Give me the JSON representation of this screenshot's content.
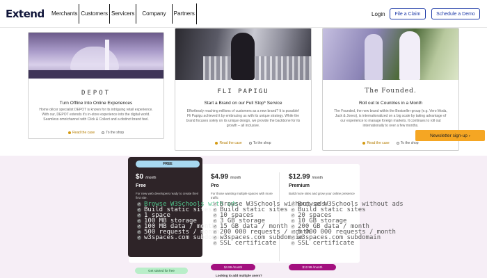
{
  "header": {
    "logo": "Extend",
    "nav": [
      "Merchants",
      "Customers",
      "Servicers",
      "Company",
      "Partners"
    ],
    "login": "Login",
    "file_claim": "File a Claim",
    "schedule_demo": "Schedule a Demo"
  },
  "cards": [
    {
      "brand": "DEPOT",
      "title": "Turn Offline Into Online Experiences",
      "desc": "Home décor specialist DEPOT is known for its intriguing retail experience. With our, DEPOT extends it's in-store experience into the digital world. Seamless omnichannel with Click & Collect and a distinct brand feel.",
      "read": "Read the case",
      "shop": "To the shop"
    },
    {
      "brand": "FLI PAPIGU",
      "title": "Start a Brand on our Full Stop* Service",
      "desc": "Effortlessly reaching millions of customers as a new brand? It is possible! Fli Papigu achieved it by embracing us with its unique strategy. While the brand focuses solely on its unique design, we provide the backbone for its growth – all inclusive.",
      "read": "Read the case",
      "shop": "To the shop"
    },
    {
      "brand": "The Founded.",
      "title": "Roll out to Countries in a Month",
      "desc": "The Founded, the new brand within the Bestseller group (e.g. Vero Moda, Jack & Jones), is internationalized on a big scale by taking advantage of our experience to manage foreign markets. It continues to roll out internationally to over a few months.",
      "read": "Read the case",
      "shop": "To the shop"
    }
  ],
  "newsletter": "Newsletter sign-up ›",
  "pricing": {
    "free": {
      "badge": "FREE",
      "price": "$0",
      "per": "/month",
      "name": "Free",
      "desc": "For new web developers ready to create their first site.",
      "features": [
        "Browse W3Schools with ads",
        "Build static sites",
        "1 space",
        "100 MB storage",
        "100 MB data / month",
        "500 requests / month",
        "w3spaces.com subdomain"
      ],
      "cta": "Get started for free"
    },
    "pro": {
      "price": "$4.99",
      "per": "/month",
      "name": "Pro",
      "desc": "For those wanting multiple spaces with more traffic",
      "features": [
        "Browse W3Schools without ads",
        "Build static sites",
        "10 spaces",
        "3 GB storage",
        "15 GB data / month",
        "200 000 requests / month",
        "w3spaces.com subdomain",
        "SSL certificate"
      ],
      "cta": "$4.99 /month"
    },
    "premium": {
      "price": "$12.99",
      "per": "/month",
      "name": "Premium",
      "desc": "Build more sites and grow your online presence",
      "features": [
        "Browse W3Schools without ads",
        "Build static sites",
        "20 spaces",
        "10 GB storage",
        "200 GB data / month",
        "5 000 000 requests / month",
        "w3spaces.com subdomain",
        "SSL certificate"
      ],
      "cta": "$12.99 /month"
    },
    "addon": "Looking to add multiple users?"
  }
}
